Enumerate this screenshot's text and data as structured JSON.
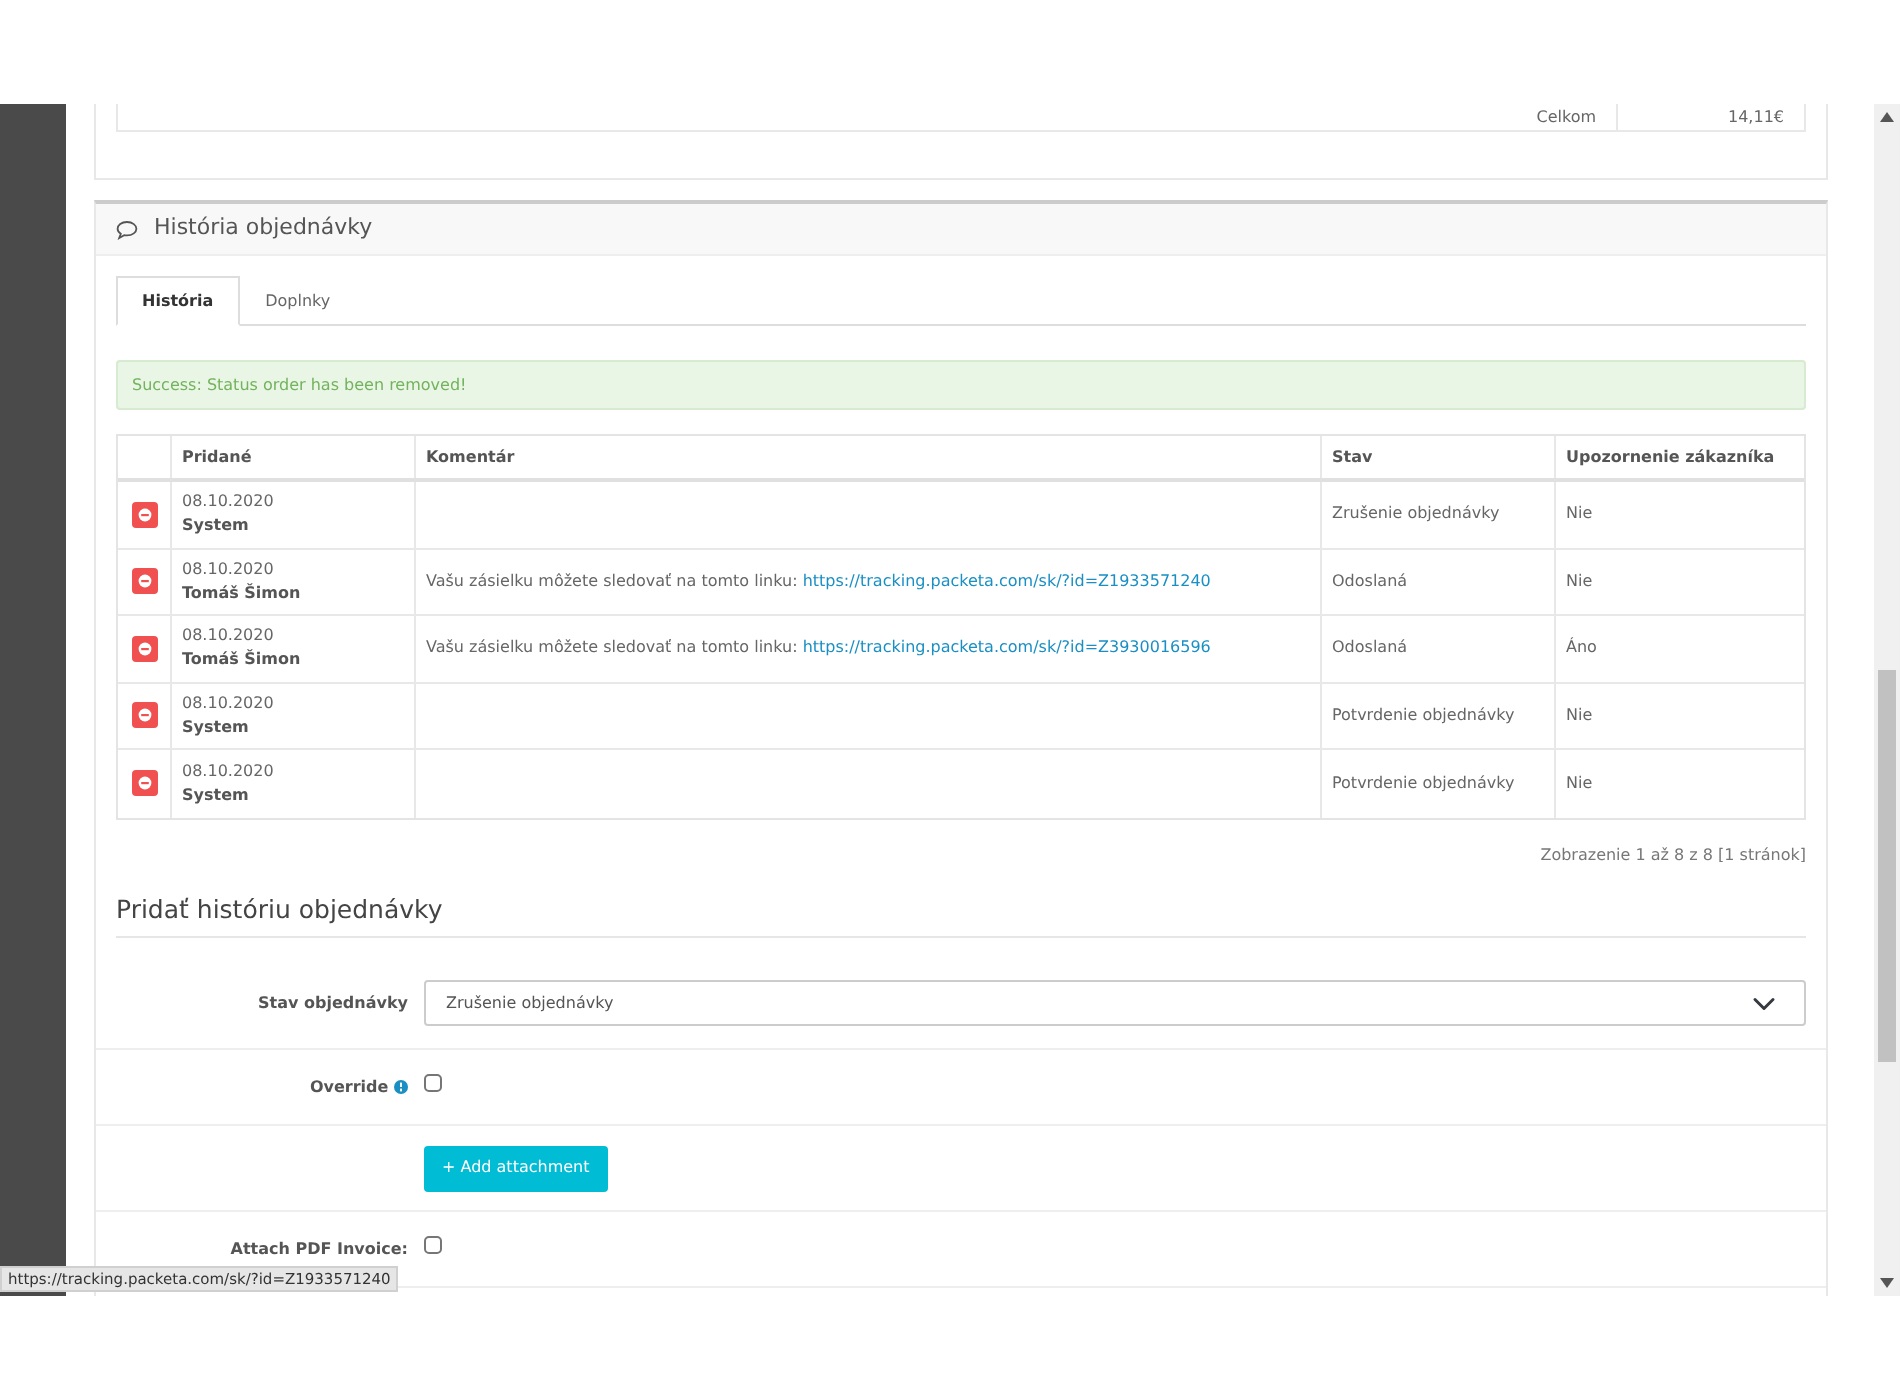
{
  "summary": {
    "label": "Celkom",
    "value": "14,11€"
  },
  "panel": {
    "title": "História objednávky"
  },
  "tabs": [
    {
      "label": "História",
      "selected": true
    },
    {
      "label": "Doplnky",
      "selected": false
    }
  ],
  "alert": "Success: Status order has been removed!",
  "table": {
    "columns": [
      "Pridané",
      "Komentár",
      "Stav",
      "Upozornenie zákazníka"
    ],
    "rows": [
      {
        "date": "08.10.2020",
        "author": "System",
        "status": "Zrušenie objednávky",
        "notify": "Nie"
      },
      {
        "date": "08.10.2020",
        "author": "Tomáš Šimon",
        "comment": "Vašu zásielku môžete sledovať na tomto linku:",
        "link": "https://tracking.packeta.com/sk/?id=Z1933571240",
        "status": "Odoslaná",
        "notify": "Nie"
      },
      {
        "date": "08.10.2020",
        "author": "Tomáš Šimon",
        "comment": "Vašu zásielku môžete sledovať na tomto linku:",
        "link": "https://tracking.packeta.com/sk/?id=Z3930016596",
        "status": "Odoslaná",
        "notify": "Áno"
      },
      {
        "date": "08.10.2020",
        "author": "System",
        "status": "Potvrdenie objednávky",
        "notify": "Nie"
      },
      {
        "date": "08.10.2020",
        "author": "System",
        "status": "Potvrdenie objednávky",
        "notify": "Nie"
      }
    ]
  },
  "pagination": "Zobrazenie 1 až 8 z 8 [1 stránok]",
  "form": {
    "title": "Pridať históriu objednávky",
    "fields": [
      {
        "kind": "select",
        "label": "Stav objednávky",
        "value": "Zrušenie objednávky"
      },
      {
        "kind": "checkbox",
        "label": "Override",
        "help": true,
        "checked": false
      },
      {
        "kind": "button",
        "label": "+ Add attachment"
      },
      {
        "kind": "checkbox",
        "label": "Attach PDF Invoice:",
        "checked": false
      }
    ]
  },
  "status_bar": "https://tracking.packeta.com/sk/?id=Z1933571240"
}
